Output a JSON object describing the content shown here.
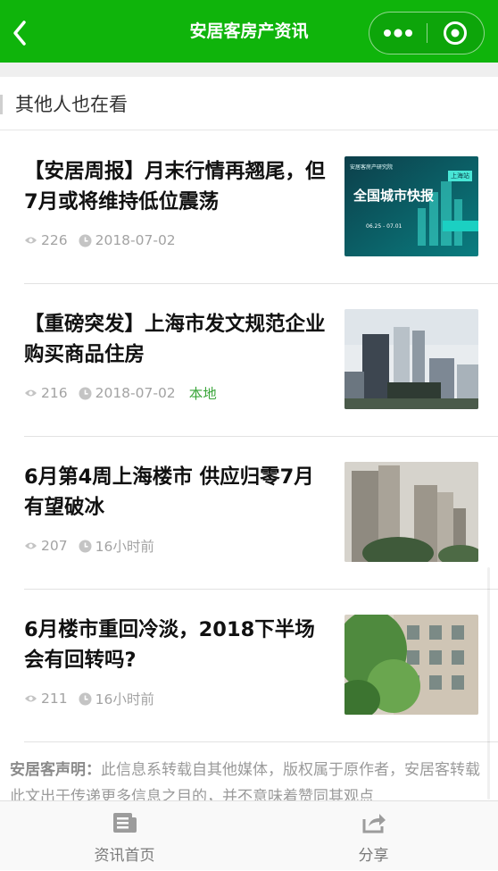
{
  "header": {
    "title": "安居客房产资讯",
    "back_icon": "chevron-left-icon",
    "more_icon": "more-dots-icon",
    "close_icon": "target-close-icon",
    "bar_color": "#0fb40b"
  },
  "section": {
    "title": "其他人也在看"
  },
  "articles": [
    {
      "title": "【安居周报】月末行情再翘尾，但7月或将维持低位震荡",
      "views": "226",
      "date": "2018-07-02",
      "tag": "",
      "thumb_text": {
        "brand": "安居客房产研究院",
        "headline": "全国城市快报",
        "city": "上海站",
        "dates": "06.25 - 07.01"
      }
    },
    {
      "title": "【重磅突发】上海市发文规范企业购买商品住房",
      "views": "216",
      "date": "2018-07-02",
      "tag": "本地"
    },
    {
      "title": "6月第4周上海楼市 供应归零7月有望破冰",
      "views": "207",
      "date": "16小时前",
      "tag": ""
    },
    {
      "title": "6月楼市重回冷淡，2018下半场会有回转吗?",
      "views": "211",
      "date": "16小时前",
      "tag": ""
    }
  ],
  "disclaimer": {
    "label": "安居客声明：",
    "text": "此信息系转载自其他媒体，版权属于原作者，安居客转载此文出于传递更多信息之目的，并不意味着赞同其观点"
  },
  "tabbar": {
    "tabs": [
      {
        "label": "资讯首页",
        "icon": "news-list-icon"
      },
      {
        "label": "分享",
        "icon": "share-icon"
      }
    ]
  }
}
